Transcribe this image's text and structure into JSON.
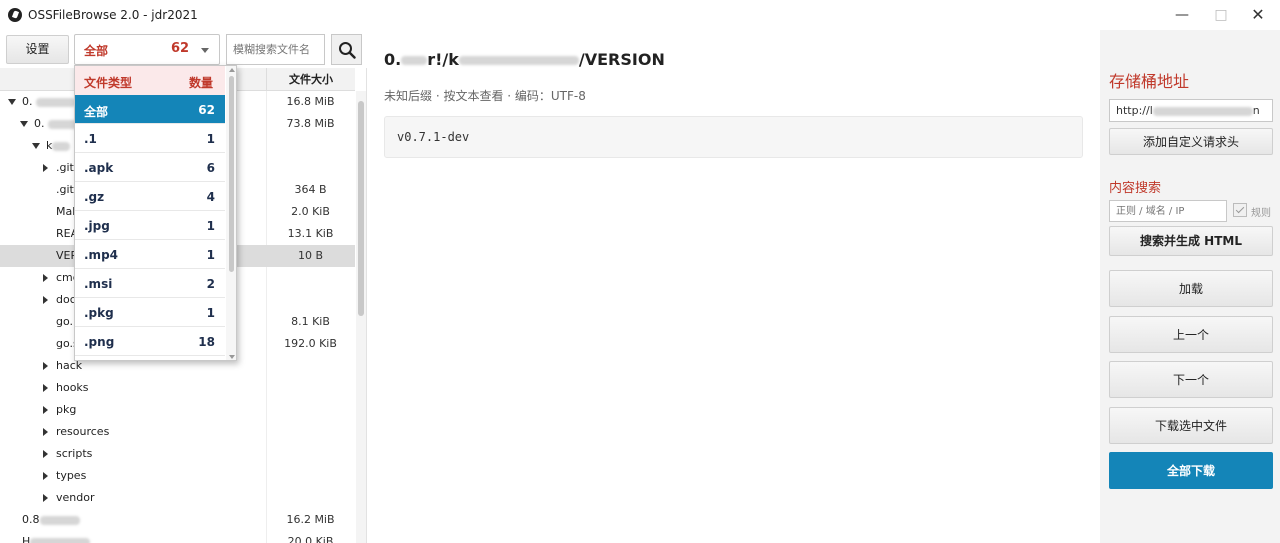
{
  "window": {
    "title": "OSSFileBrowse 2.0 - jdr2021",
    "minimize": "—",
    "maximize": "□",
    "close": "✕"
  },
  "toolbar": {
    "settings_label": "设置",
    "type_filter_label": "全部",
    "type_filter_count": "62",
    "search_placeholder": "模糊搜索文件名"
  },
  "tree": {
    "size_header": "文件大小",
    "rows": [
      {
        "name": "0.",
        "size": "16.8 MiB"
      },
      {
        "name": "0.",
        "size": "73.8 MiB"
      },
      {
        "name": "k",
        "size": ""
      },
      {
        "name": ".gitl",
        "size": ""
      },
      {
        "name": ".giti",
        "size": "364 B"
      },
      {
        "name": "Mak",
        "size": "2.0 KiB"
      },
      {
        "name": "REA",
        "size": "13.1 KiB"
      },
      {
        "name": "VER",
        "size": "10 B"
      },
      {
        "name": "cmd",
        "size": ""
      },
      {
        "name": "doc",
        "size": ""
      },
      {
        "name": "go.r",
        "size": "8.1 KiB"
      },
      {
        "name": "go.s",
        "size": "192.0 KiB"
      },
      {
        "name": "hack",
        "size": ""
      },
      {
        "name": "hooks",
        "size": ""
      },
      {
        "name": "pkg",
        "size": ""
      },
      {
        "name": "resources",
        "size": ""
      },
      {
        "name": "scripts",
        "size": ""
      },
      {
        "name": "types",
        "size": ""
      },
      {
        "name": "vendor",
        "size": ""
      },
      {
        "name": "0.8",
        "size": "16.2 MiB"
      },
      {
        "name": "H",
        "size": "20.0 KiB"
      }
    ]
  },
  "dropdown": {
    "header_type": "文件类型",
    "header_count": "数量",
    "items": [
      {
        "ext": "全部",
        "count": "62"
      },
      {
        "ext": ".1",
        "count": "1"
      },
      {
        "ext": ".apk",
        "count": "6"
      },
      {
        "ext": ".gz",
        "count": "4"
      },
      {
        "ext": ".jpg",
        "count": "1"
      },
      {
        "ext": ".mp4",
        "count": "1"
      },
      {
        "ext": ".msi",
        "count": "2"
      },
      {
        "ext": ".pkg",
        "count": "1"
      },
      {
        "ext": ".png",
        "count": "18"
      }
    ]
  },
  "main": {
    "path_prefix": "0.",
    "path_mid": "r!/k",
    "path_suffix": "/VERSION",
    "meta": "未知后缀 · 按文本查看 · 编码：UTF-8",
    "content": "v0.7.1-dev"
  },
  "sidebar": {
    "bucket_title": "存储桶地址",
    "bucket_url": "http://l",
    "bucket_url_tail": "n",
    "custom_header_btn": "添加自定义请求头",
    "content_search_title": "内容搜索",
    "regex_placeholder": "正则 / 域名 / IP",
    "regex_label": "规则",
    "search_generate_btn": "搜索并生成 HTML",
    "load_btn": "加载",
    "prev_btn": "上一个",
    "next_btn": "下一个",
    "download_selected_btn": "下载选中文件",
    "download_all_btn": "全部下载"
  },
  "colors": {
    "accent_red": "#c0392b",
    "primary_blue": "#1485b8"
  }
}
